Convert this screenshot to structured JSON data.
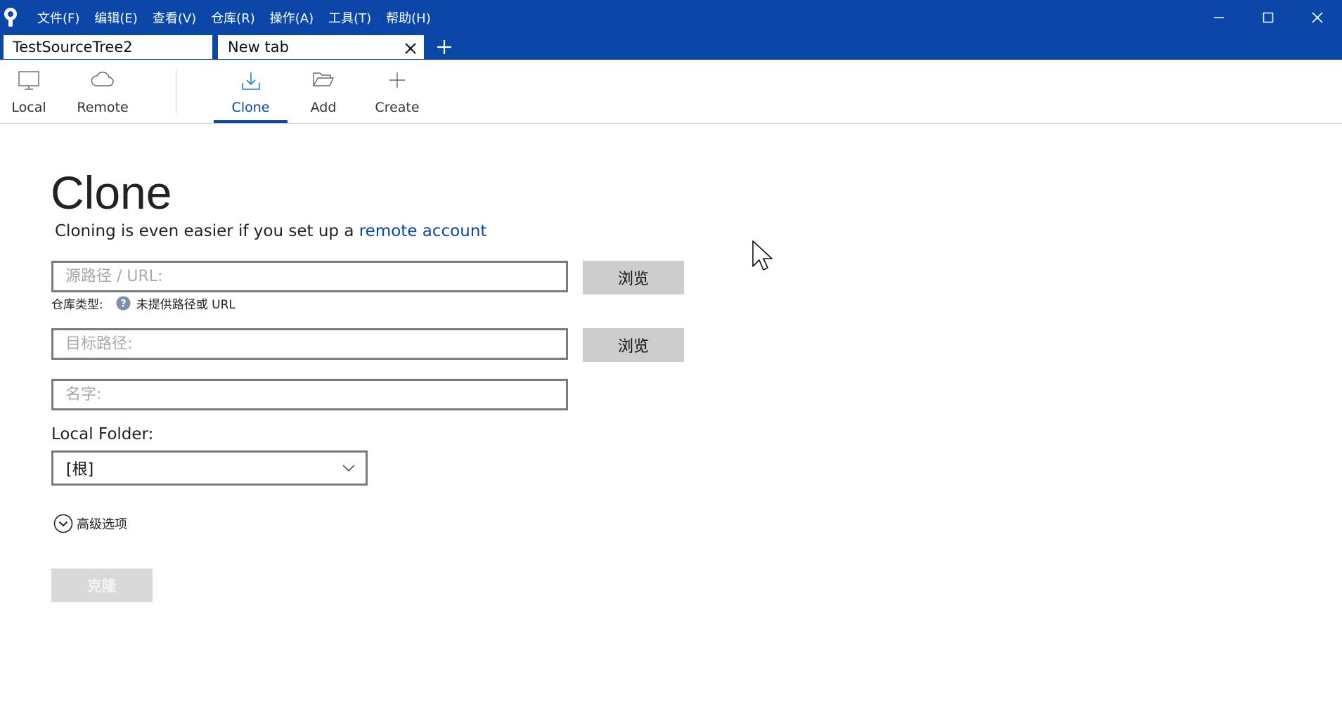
{
  "menu": {
    "items": [
      "文件(F)",
      "编辑(E)",
      "查看(V)",
      "仓库(R)",
      "操作(A)",
      "工具(T)",
      "帮助(H)"
    ]
  },
  "window_controls": [
    "minimize-icon",
    "maximize-icon",
    "close-icon"
  ],
  "tabs": [
    {
      "label": "TestSourceTree2",
      "active": false
    },
    {
      "label": "New tab",
      "active": true
    }
  ],
  "toolbar": {
    "items": [
      {
        "label": "Local",
        "icon": "monitor-icon"
      },
      {
        "label": "Remote",
        "icon": "cloud-icon"
      },
      {
        "label": "Clone",
        "icon": "download-icon",
        "active": true
      },
      {
        "label": "Add",
        "icon": "folder-open-icon"
      },
      {
        "label": "Create",
        "icon": "plus-icon"
      }
    ]
  },
  "clone": {
    "title": "Clone",
    "subtitle_prefix": "Cloning is even easier if you set up a ",
    "subtitle_link": "remote account",
    "source_placeholder": "源路径 / URL:",
    "browse_label": "浏览",
    "repo_type_label": "仓库类型:",
    "repo_type_value": "未提供路径或 URL",
    "dest_placeholder": "目标路径:",
    "name_placeholder": "名字:",
    "local_folder_label": "Local Folder:",
    "local_folder_value": "[根]",
    "advanced_label": "高级选项",
    "clone_button": "克隆"
  },
  "colors": {
    "accent": "#0a47a8",
    "disabled_button": "#d9d9d9",
    "browse_button": "#cccccc"
  }
}
